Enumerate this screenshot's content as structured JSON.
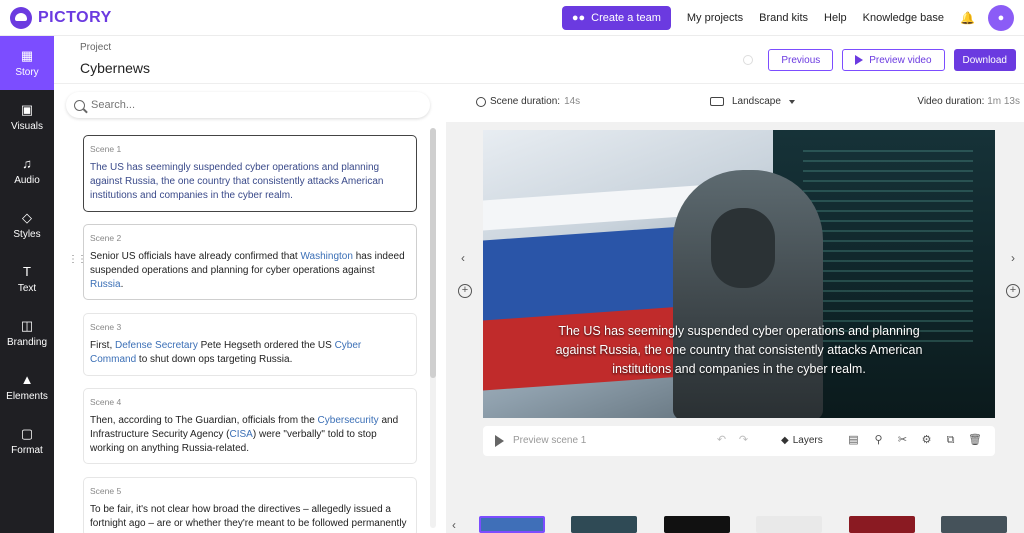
{
  "app": {
    "logo": "PICTORY"
  },
  "topnav": {
    "create_team": "Create a team",
    "links": [
      "My projects",
      "Brand kits",
      "Help",
      "Knowledge base"
    ]
  },
  "sidebar": {
    "items": [
      {
        "label": "Story",
        "icon": "story-icon",
        "active": true
      },
      {
        "label": "Visuals",
        "icon": "visuals-icon",
        "active": false
      },
      {
        "label": "Audio",
        "icon": "audio-icon",
        "active": false
      },
      {
        "label": "Styles",
        "icon": "styles-icon",
        "active": false
      },
      {
        "label": "Text",
        "icon": "text-icon",
        "active": false
      },
      {
        "label": "Branding",
        "icon": "branding-icon",
        "active": false
      },
      {
        "label": "Elements",
        "icon": "elements-icon",
        "active": false
      },
      {
        "label": "Format",
        "icon": "format-icon",
        "active": false
      }
    ]
  },
  "project": {
    "label": "Project",
    "name": "Cybernews",
    "previous": "Previous",
    "preview_video": "Preview video",
    "download": "Download"
  },
  "search": {
    "placeholder": "Search..."
  },
  "scenes": [
    {
      "title": "Scene 1",
      "text": "The US has seemingly suspended cyber operations and planning against Russia, the one country that consistently attacks American institutions and companies in the cyber realm."
    },
    {
      "title": "Scene 2",
      "text_a": "Senior US officials have already confirmed that ",
      "kw1": "Washington",
      "text_b": " has indeed suspended operations and planning for cyber operations against ",
      "kw2": "Russia",
      "text_c": "."
    },
    {
      "title": "Scene 3",
      "text_a": "First, ",
      "kw1": "Defense Secretary",
      "text_b": " Pete Hegseth ordered the US ",
      "kw2": "Cyber Command",
      "text_c": " to shut down ops targeting Russia."
    },
    {
      "title": "Scene 4",
      "text_a": "Then, according to The Guardian, officials from the ",
      "kw1": "Cybersecurity",
      "text_b": " and Infrastructure Security Agency (",
      "kw2": "CISA",
      "text_c": ") were \"verbally\" told to stop working on anything Russia-related."
    },
    {
      "title": "Scene 5",
      "text": "To be fair, it's not clear how broad the directives – allegedly issued a fortnight ago – are or whether they're meant to be followed permanently"
    }
  ],
  "preview": {
    "scene_duration_label": "Scene duration:",
    "scene_duration_value": "14s",
    "orientation": "Landscape",
    "video_duration_label": "Video duration:",
    "video_duration_value": "1m 13s",
    "caption": "The US has seemingly suspended cyber operations and planning against Russia, the one country that consistently attacks American institutions and companies in the cyber realm.",
    "preview_scene": "Preview scene 1",
    "layers": "Layers"
  },
  "colors": {
    "accent": "#6b3ae0",
    "sidebar_bg": "#1f1f23",
    "sidebar_active": "#7c4dff"
  }
}
